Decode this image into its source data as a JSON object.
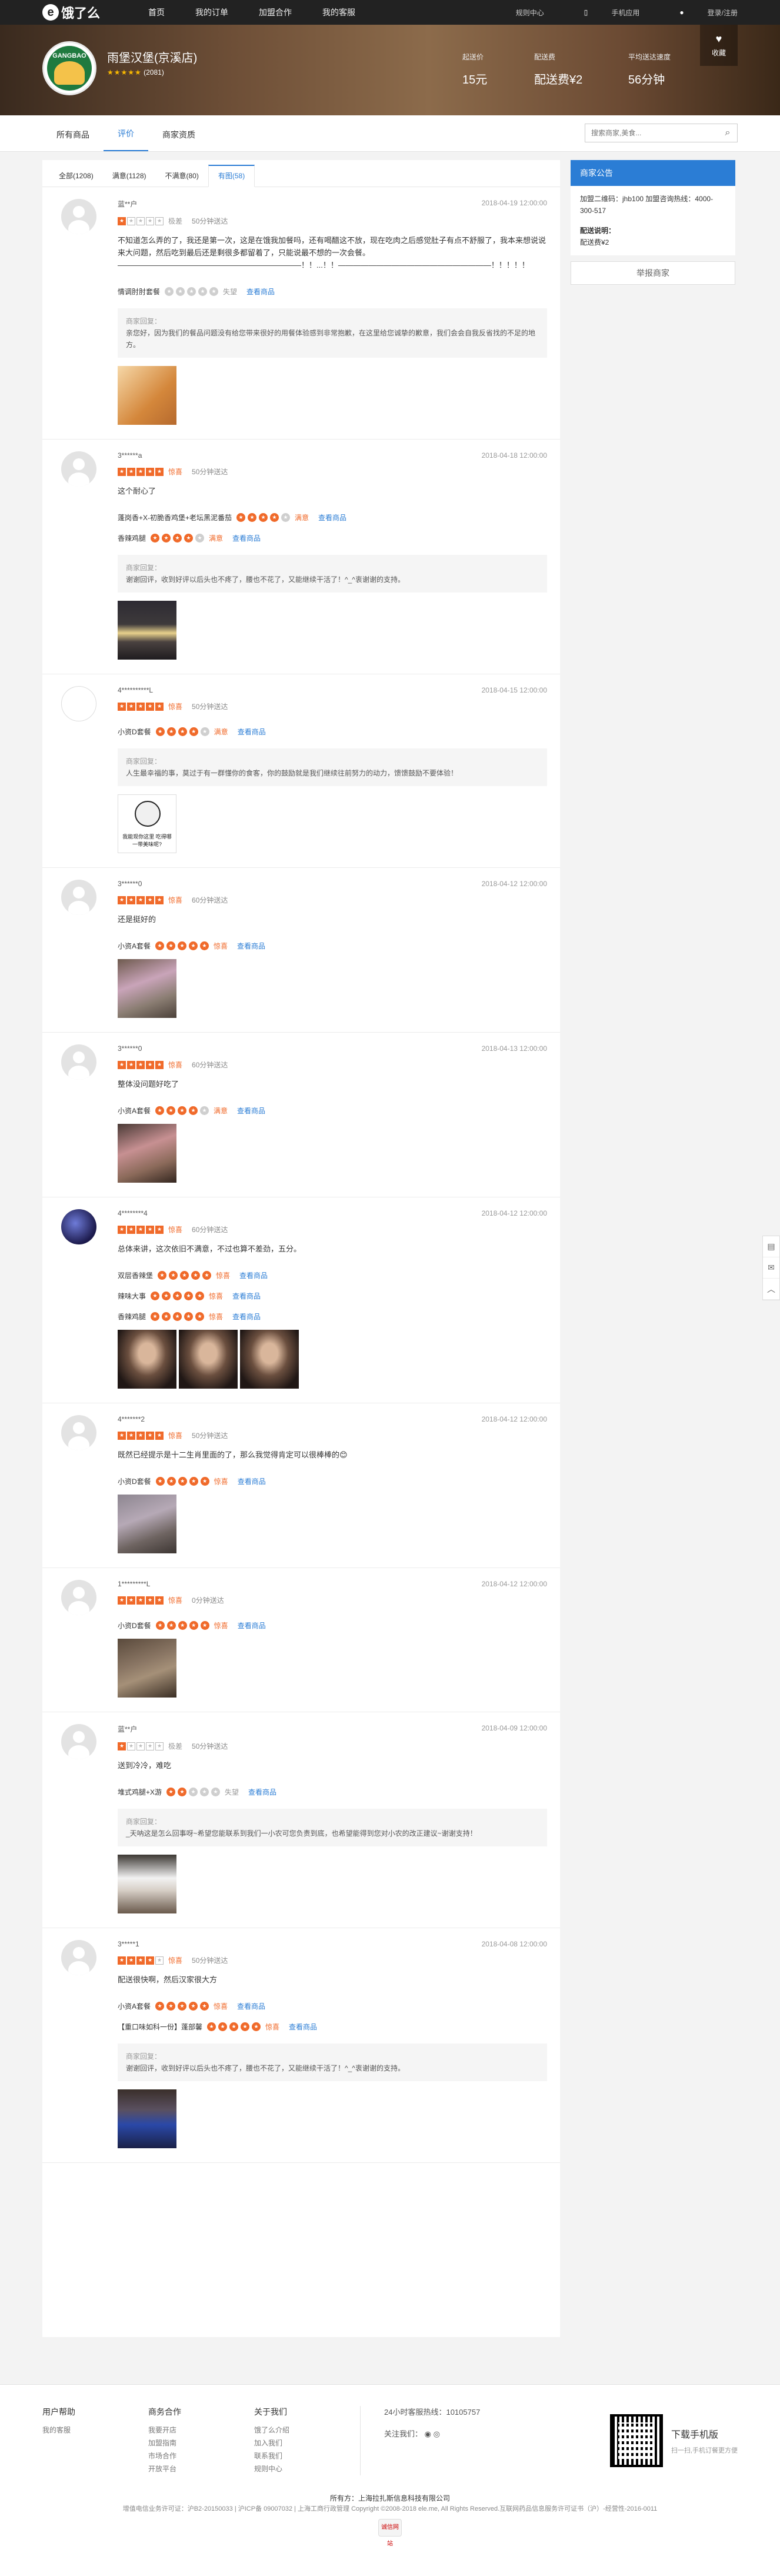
{
  "topbar": {
    "logo": "饿了么",
    "nav": [
      "首页",
      "我的订单",
      "加盟合作",
      "我的客服"
    ],
    "service_center": "规则中心",
    "mobile_app": "手机应用",
    "login": "登录/注册"
  },
  "shop": {
    "name": "雨堡汉堡(京溪店)",
    "rating_count": "(2081)",
    "stats": [
      {
        "label": "起送价",
        "value": "15元"
      },
      {
        "label": "配送费",
        "value": "配送费¥2"
      },
      {
        "label": "平均送达速度",
        "value": "56分钟"
      }
    ],
    "favorite": "收藏"
  },
  "tabs": [
    "所有商品",
    "评价",
    "商家资质"
  ],
  "search": {
    "placeholder": "搜索商家,美食..."
  },
  "filters": [
    "全部(1208)",
    "满意(1128)",
    "不满意(80)",
    "有图(58)"
  ],
  "reviews": [
    {
      "user": "蓝**户",
      "time": "2018-04-19 12:00:00",
      "rating_label": "极差",
      "delivery": "50分钟送达",
      "text": "不知道怎么弄的了，我还是第一次，这是在饿我加餐吗，还有喝醋这不放，现在吃肉之后感觉肚子有点不舒服了，我本来想说说来大问题，然后吃到最后还是剩很多都留着了，只能说最不想的一次会餐。――――――――――――――――――――――――！！...！！――――――――――――――――――――！！！！！",
      "dishes": [
        {
          "name": "情调肘肘套餐",
          "label": "失望",
          "view": "查看商品"
        }
      ],
      "reply_head": "商家回复：",
      "reply": "亲您好，因为我们的餐品问题没有给您带来很好的用餐体验感到非常抱歉，在这里给您诚挚的歉意，我们会会自我反省找的不足的地方。"
    },
    {
      "user": "3******a",
      "time": "2018-04-18 12:00:00",
      "rating_label": "惊喜",
      "delivery": "50分钟送达",
      "text": "这个耐心了",
      "dishes": [
        {
          "name": "蓬岗香+X-初脆香鸡堡+老坛黑泥番茄",
          "label": "满意",
          "view": "查看商品"
        },
        {
          "name": "香辣鸡腿",
          "label": "满意",
          "view": "查看商品"
        }
      ],
      "reply_head": "商家回复：",
      "reply": "谢谢回评，收到好评以后头也不疼了，腰也不花了，又能继续干活了！^_^衷谢谢的支持。"
    },
    {
      "user": "4**********L",
      "time": "2018-04-15 12:00:00",
      "rating_label": "惊喜",
      "delivery": "50分钟送达",
      "text": "",
      "dishes": [
        {
          "name": "小资D套餐",
          "label": "满意",
          "view": "查看商品"
        }
      ],
      "reply_head": "商家回复：",
      "reply": "人生最幸福的事，莫过于有一群懂你的食客，你的鼓励就是我们继续往前努力的动力，馈馈鼓励不要体验！",
      "photo_caption": "我能现你这里 吃得哪一带美味呢?"
    },
    {
      "user": "3******0",
      "time": "2018-04-12 12:00:00",
      "rating_label": "惊喜",
      "delivery": "60分钟送达",
      "text": "还是挺好的",
      "dishes": [
        {
          "name": "小资A套餐",
          "label": "惊喜",
          "view": "查看商品"
        }
      ]
    },
    {
      "user": "3******0",
      "time": "2018-04-13 12:00:00",
      "rating_label": "惊喜",
      "delivery": "60分钟送达",
      "text": "整体没问题好吃了",
      "dishes": [
        {
          "name": "小资A套餐",
          "label": "满意",
          "view": "查看商品"
        }
      ]
    },
    {
      "user": "4********4",
      "time": "2018-04-12 12:00:00",
      "rating_label": "惊喜",
      "delivery": "60分钟送达",
      "text": "总体来讲，这次依旧不满意，不过也算不差劲，五分。",
      "dishes": [
        {
          "name": "双层香辣堡",
          "label": "惊喜",
          "view": "查看商品"
        },
        {
          "name": "辣味大事",
          "label": "惊喜",
          "view": "查看商品"
        },
        {
          "name": "香辣鸡腿",
          "label": "惊喜",
          "view": "查看商品"
        }
      ]
    },
    {
      "user": "4*******2",
      "time": "2018-04-12 12:00:00",
      "rating_label": "惊喜",
      "delivery": "50分钟送达",
      "text": "既然已经提示是十二生肖里面的了，那么我觉得肯定可以很棒棒的😊",
      "dishes": [
        {
          "name": "小资D套餐",
          "label": "惊喜",
          "view": "查看商品"
        }
      ]
    },
    {
      "user": "1*********L",
      "time": "2018-04-12 12:00:00",
      "rating_label": "惊喜",
      "delivery": "0分钟送达",
      "text": "",
      "dishes": [
        {
          "name": "小资D套餐",
          "label": "惊喜",
          "view": "查看商品"
        }
      ]
    },
    {
      "user": "蓝**户",
      "time": "2018-04-09 12:00:00",
      "rating_label": "极差",
      "delivery": "50分钟送达",
      "text": "送到冷冷，难吃",
      "dishes": [
        {
          "name": "堆式鸡腿+X游",
          "label": "失望",
          "view": "查看商品"
        }
      ],
      "reply_head": "商家回复：",
      "reply": "_天呐这是怎么回事呀~希望您能联系到我们一小农可您负责到底，也希望能得到您对小农的改正建议~谢谢支持！"
    },
    {
      "user": "3*****1",
      "time": "2018-04-08 12:00:00",
      "rating_label": "惊喜",
      "delivery": "50分钟送达",
      "text": "配送很快啊，然后汉家很大方",
      "dishes": [
        {
          "name": "小资A套餐",
          "label": "惊喜",
          "view": "查看商品"
        },
        {
          "name": "【重口味如科一份】蓬部馨",
          "label": "惊喜",
          "view": "查看商品"
        }
      ],
      "reply_head": "商家回复：",
      "reply": "谢谢回评，收到好评以后头也不疼了，腰也不花了，又能继续干活了！^_^衷谢谢的支持。"
    }
  ],
  "notice": {
    "title": "商家公告",
    "body": "加盟二维码：jhb100 加盟咨询热线：4000-300-517",
    "delivery_title": "配送说明：",
    "delivery_fee": "配送费¥2",
    "report": "举报商家"
  },
  "footer": {
    "cols": [
      {
        "title": "用户帮助",
        "items": [
          "我的客服"
        ]
      },
      {
        "title": "商务合作",
        "items": [
          "我要开店",
          "加盟指南",
          "市场合作",
          "开放平台"
        ]
      },
      {
        "title": "关于我们",
        "items": [
          "饿了么介绍",
          "加入我们",
          "联系我们",
          "规则中心"
        ]
      }
    ],
    "hotline": "24小时客服热线：10105757",
    "follow": "关注我们：",
    "app_title": "下载手机版",
    "app_sub": "扫一扫,手机订餐更方便",
    "owner": "所有方：上海拉扎斯信息科技有限公司",
    "icp": "增值电信业务许可证：沪B2-20150033 | 沪ICP备 09007032 | 上海工商行政管理 Copyright ©2008-2018 ele.me, All Rights Reserved.互联网药品信息服务许可证书（沪）-经营性-2016-0011",
    "badge": "诚信网站"
  },
  "colors": {
    "accent": "#2b7dd5",
    "rating": "#f06a2a",
    "topbar": "#222222"
  }
}
